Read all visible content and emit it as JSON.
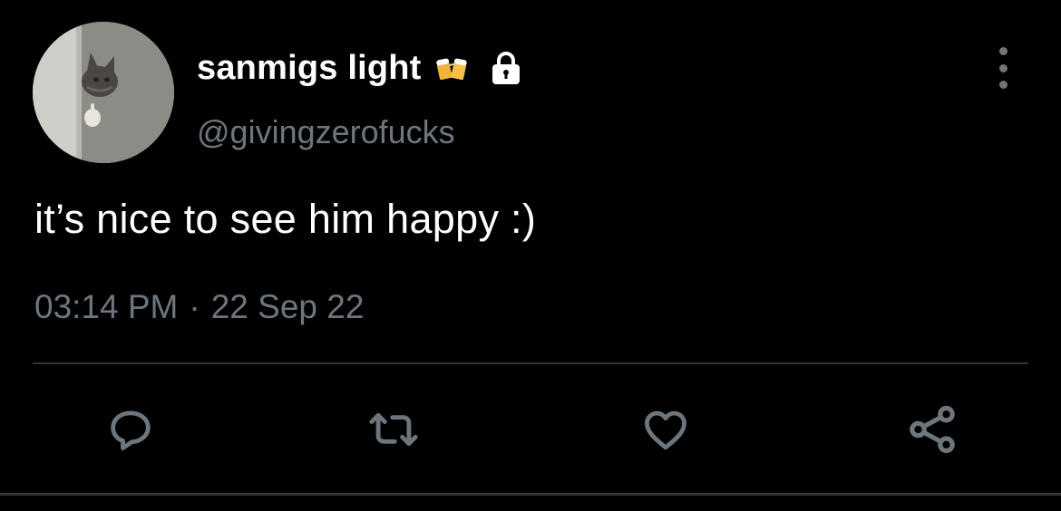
{
  "user": {
    "display_name": "sanmigs light",
    "handle": "@givingzerofucks",
    "emoji_icon": "beer-mugs-emoji",
    "lock_icon": "lock-icon",
    "avatar": "cat-peeking-avatar"
  },
  "tweet": {
    "text": "it’s nice to see him happy :)",
    "time": "03:14 PM",
    "separator": "·",
    "date": "22 Sep 22"
  },
  "actions": [
    {
      "name": "reply",
      "icon": "reply-bubble-icon"
    },
    {
      "name": "retweet",
      "icon": "retweet-icon"
    },
    {
      "name": "like",
      "icon": "heart-icon"
    },
    {
      "name": "share",
      "icon": "share-icon"
    }
  ],
  "colors": {
    "background": "#000000",
    "primary_text": "#ffffff",
    "secondary_text": "#6e767d",
    "divider": "#2f3336"
  }
}
